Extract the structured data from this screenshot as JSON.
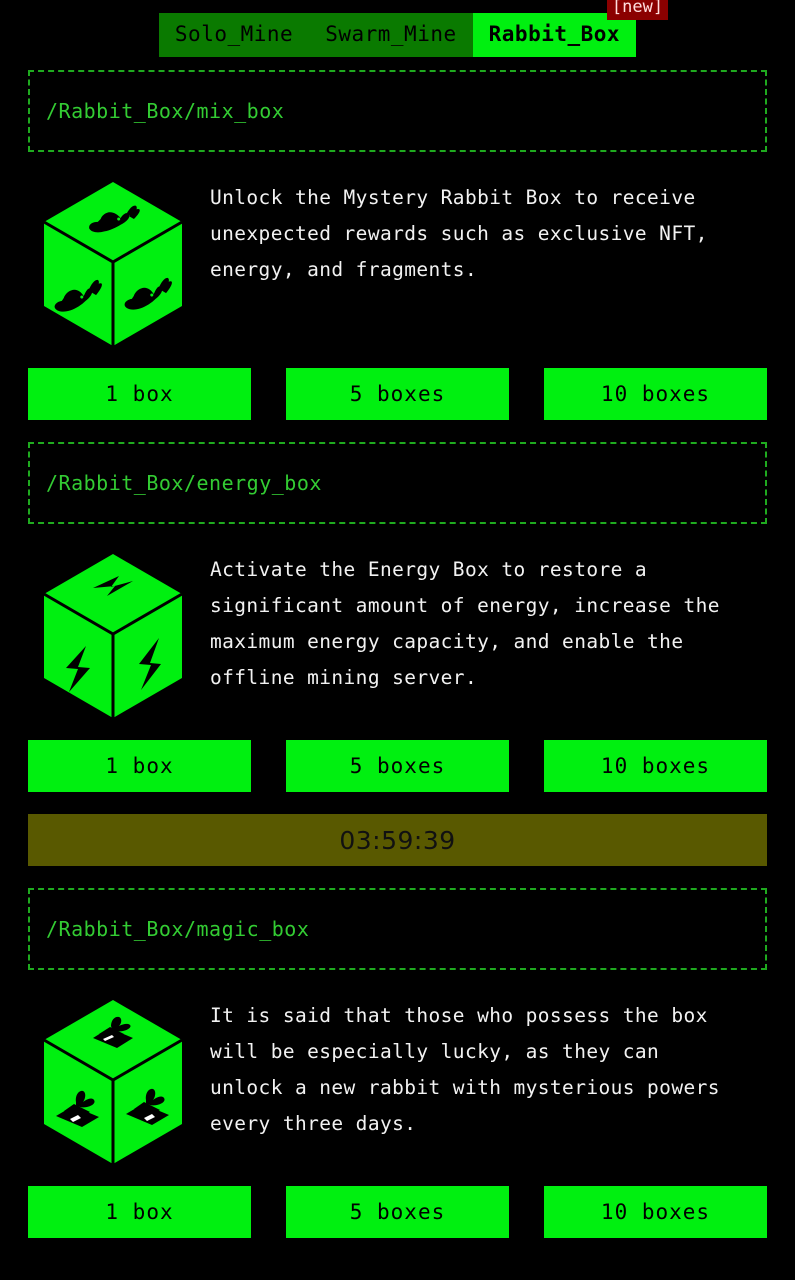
{
  "tabs": [
    {
      "label": "Solo_Mine",
      "active": false
    },
    {
      "label": "Swarm_Mine",
      "active": false
    },
    {
      "label": "Rabbit_Box",
      "active": true
    }
  ],
  "new_badge": "[new]",
  "colors": {
    "background": "#000000",
    "accent_green": "#00f010",
    "tab_inactive": "#0a7a00",
    "path_border": "#1faa1f",
    "path_text": "#33cc33",
    "badge_bg": "#8b0000",
    "timer_bg": "#595900",
    "timer_text": "#111111",
    "description_text": "#f2f2f2"
  },
  "sections": [
    {
      "path": "/Rabbit_Box/mix_box",
      "icon": "rabbit-cube-icon",
      "description": "Unlock the Mystery Rabbit Box to receive unexpected rewards such as exclusive NFT, energy, and fragments.",
      "buttons": [
        "1 box",
        "5 boxes",
        "10 boxes"
      ],
      "timer": null
    },
    {
      "path": "/Rabbit_Box/energy_box",
      "icon": "energy-cube-icon",
      "description": "Activate the Energy Box to restore a significant amount of energy, increase the maximum energy capacity, and enable the offline mining server.",
      "buttons": [
        "1 box",
        "5 boxes",
        "10 boxes"
      ],
      "timer": "03:59:39"
    },
    {
      "path": "/Rabbit_Box/magic_box",
      "icon": "magic-hat-cube-icon",
      "description": "It is said that those who possess the box will be especially lucky, as they can unlock a new rabbit with mysterious powers every three days.",
      "buttons": [
        "1 box",
        "5 boxes",
        "10 boxes"
      ],
      "timer": null
    }
  ]
}
